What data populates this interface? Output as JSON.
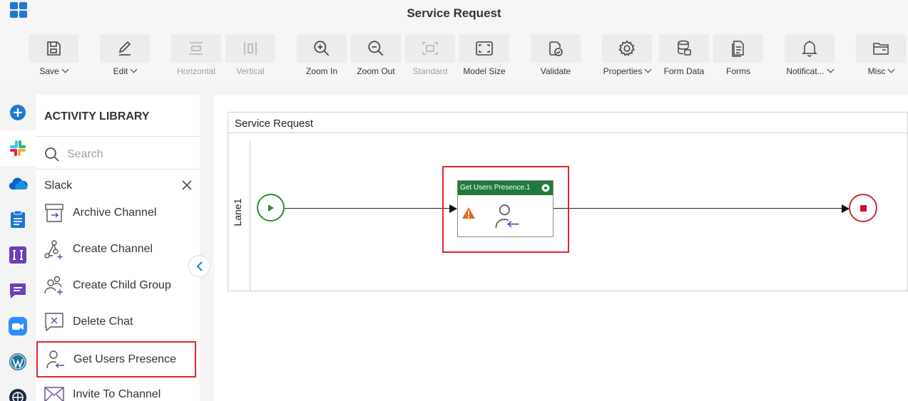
{
  "app": {
    "title": "Service Request"
  },
  "toolbar": {
    "save": "Save",
    "edit": "Edit",
    "horizontal": "Horizontal",
    "vertical": "Vertical",
    "zoom_in": "Zoom In",
    "zoom_out": "Zoom Out",
    "standard": "Standard",
    "model_size": "Model Size",
    "validate": "Validate",
    "properties": "Properties",
    "form_data": "Form Data",
    "forms": "Forms",
    "notifications": "Notificat...",
    "misc": "Misc"
  },
  "rail": {
    "items": [
      "add-icon",
      "slack-icon",
      "onedrive-icon",
      "clipboard-icon",
      "integration-icon",
      "chat-icon",
      "zoom-icon",
      "wordpress-icon",
      "globe-icon"
    ],
    "active": "slack-icon"
  },
  "library": {
    "title": "ACTIVITY LIBRARY",
    "search_placeholder": "Search",
    "category": "Slack",
    "items": [
      {
        "label": "Archive Channel",
        "icon": "archive-channel-icon"
      },
      {
        "label": "Create Channel",
        "icon": "create-channel-icon"
      },
      {
        "label": "Create Child Group",
        "icon": "create-child-group-icon"
      },
      {
        "label": "Delete Chat",
        "icon": "delete-chat-icon"
      },
      {
        "label": "Get Users Presence",
        "icon": "get-users-presence-icon",
        "highlighted": true
      },
      {
        "label": "Invite To Channel",
        "icon": "invite-to-channel-icon"
      }
    ]
  },
  "canvas": {
    "pool_title": "Service Request",
    "lane_label": "Lane1",
    "task": {
      "title": "Get Users Presence.1",
      "status": "warning"
    }
  },
  "colors": {
    "accent_blue": "#1f78d1",
    "task_header_green": "#1f7a3b",
    "start_green": "#2e8b3e",
    "end_red": "#c0323a",
    "highlight_red": "#e0282e",
    "slack_purple": "#6b3fb8"
  }
}
